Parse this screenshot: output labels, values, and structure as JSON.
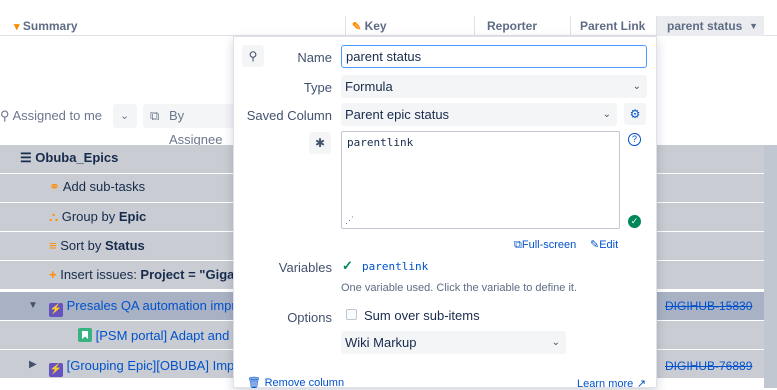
{
  "header": {
    "summary": "Summary",
    "key": "Key",
    "reporter": "Reporter",
    "parent_link": "Parent Link",
    "parent_status": "parent status"
  },
  "filters": {
    "assigned_to_me": "Assigned to me",
    "by_assignee": "By Assignee"
  },
  "rows": [
    {
      "label": "Obuba_Epics"
    },
    {
      "label": "Add sub-tasks"
    },
    {
      "label_prefix": "Group by ",
      "label_bold": "Epic"
    },
    {
      "label_prefix": "Sort by ",
      "label_bold": "Status"
    },
    {
      "label_prefix": "Insert issues: ",
      "label_bold": "Project = \"Giga"
    },
    {
      "label": "Presales QA automation impro",
      "key": "DIGIHUB-15830"
    },
    {
      "label": "[PSM portal] Adapt and a"
    },
    {
      "label": "[Grouping Epic][OBUBA] Impro",
      "key": "DIGIHUB-76889"
    }
  ],
  "popup": {
    "name_label": "Name",
    "name_value": "parent status",
    "type_label": "Type",
    "type_value": "Formula",
    "saved_column_label": "Saved Column",
    "saved_column_value": "Parent epic status",
    "formula_text": "parentlink",
    "full_screen": "Full-screen",
    "edit": "Edit",
    "variables_label": "Variables",
    "variable_name": "parentlink",
    "variables_hint": "One variable used. Click the variable to define it.",
    "options_label": "Options",
    "sum_over_subitems": "Sum over sub-items",
    "markup_value": "Wiki Markup",
    "remove_column": "Remove column",
    "learn_more": "Learn more"
  },
  "colors": {
    "row_grey": "#c9ccd2",
    "row_selected": "#a9b1c4",
    "epic": "#6554c0",
    "accent": "#0052cc",
    "ok": "#00875a"
  }
}
